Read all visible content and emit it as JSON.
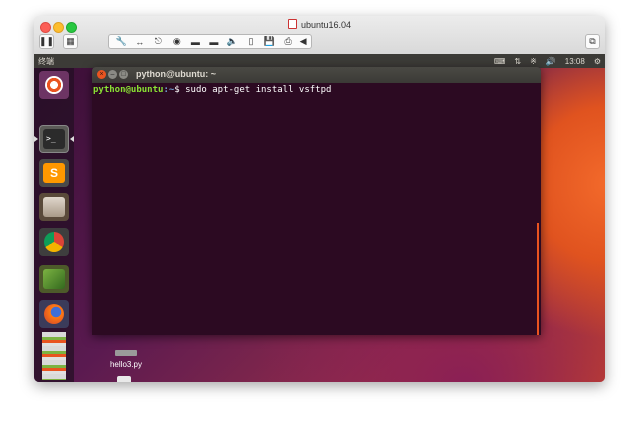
{
  "vm": {
    "title": "ubuntu16.04",
    "toolbar": {
      "pause_icon": "pause-icon",
      "settings_icon": "vm-settings-icon",
      "devices": [
        "wrench-icon",
        "arrows-icon",
        "usb-icon",
        "camera-icon",
        "drive-icon",
        "disk-icon",
        "speaker-icon",
        "hdd-icon",
        "floppy-icon",
        "printer-icon",
        "chevron-left-icon"
      ],
      "fullscreen_icon": "window-icon"
    }
  },
  "ubuntu": {
    "top_panel": {
      "app_title": "终端",
      "clock": "13:08",
      "indicators": [
        "keyboard-icon",
        "network-icon",
        "bluetooth-icon",
        "volume-icon"
      ]
    },
    "launcher": [
      "dash-icon",
      "terminal-icon",
      "sublime-text-icon",
      "files-icon",
      "chrome-icon",
      "books-icon",
      "firefox-icon",
      "stacked-apps-icon"
    ],
    "terminal": {
      "title": "python@ubuntu: ~",
      "prompt_user": "python@ubuntu",
      "prompt_path": ":~",
      "prompt_symbol": "$",
      "command": " sudo apt-get install vsftpd"
    },
    "desktop": {
      "file_label": "hello3.py"
    }
  },
  "colors": {
    "ubuntu_orange": "#e95420",
    "terminal_bg": "#2c0a22",
    "prompt_green": "#8ae234",
    "prompt_blue": "#729fcf"
  }
}
